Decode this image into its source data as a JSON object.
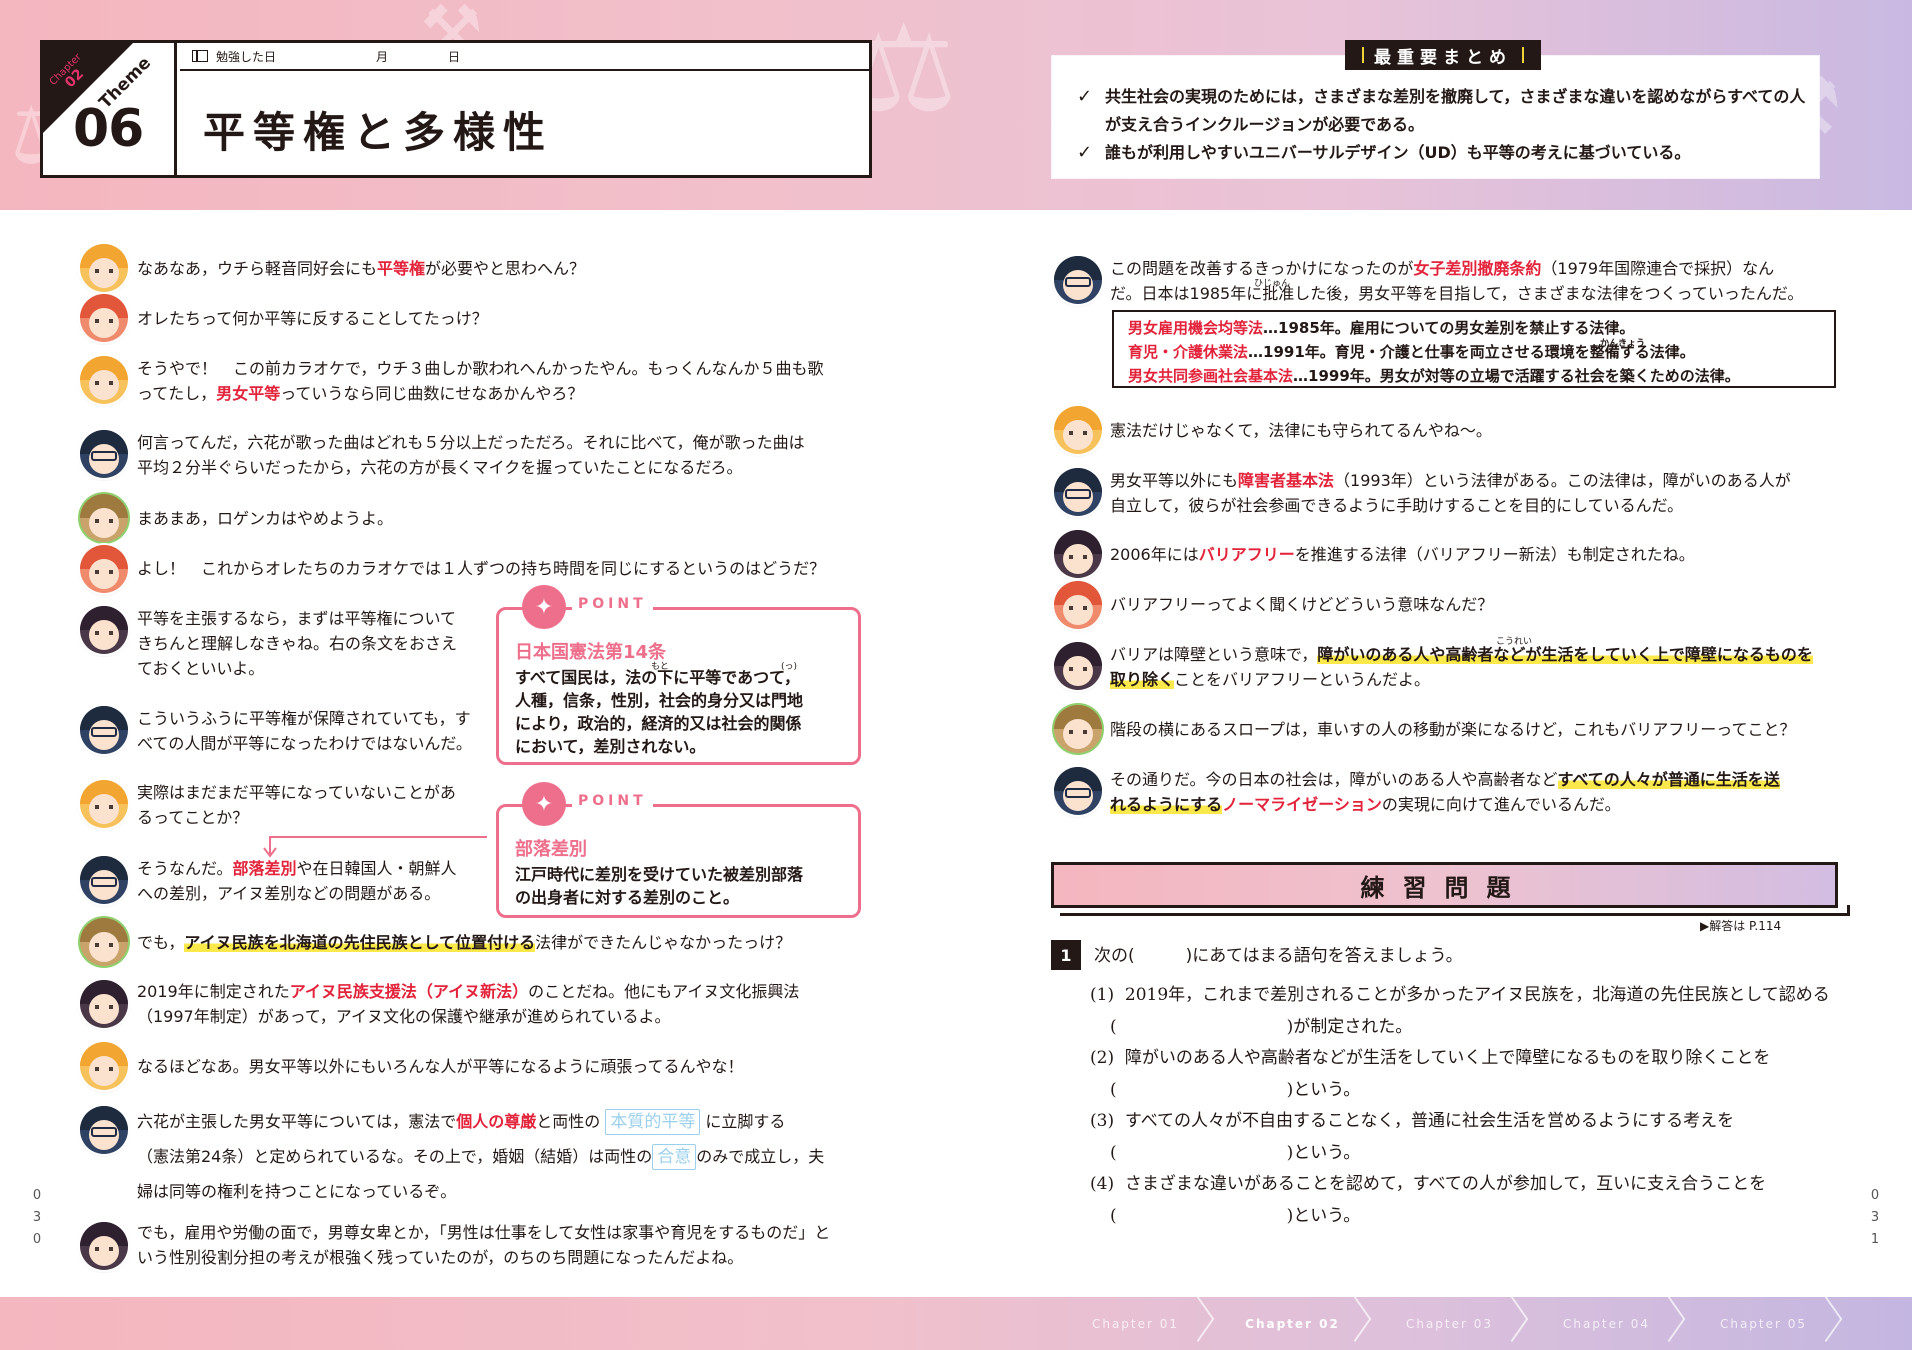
{
  "header": {
    "chapter_word": "Chapter",
    "chapter_num": "02",
    "theme_word": "Theme",
    "theme_num": "06",
    "study_label": "勉強した日",
    "month_label": "月",
    "day_label": "日",
    "title": "平等権と多様性"
  },
  "summary": {
    "heading": "最重要まとめ",
    "items": [
      "共生社会の実現のためには，さまざまな差別を撤廃して，さまざまな違いを認めながらすべての人が支え合うインクルージョンが必要である。",
      "誰もが利用しやすいユニバーサルデザイン（UD）も平等の考えに基づいている。"
    ]
  },
  "left": {
    "d1": {
      "a": "なあなあ，ウチら軽音同好会にも",
      "b": "平等権",
      "c": "が必要やと思わへん？"
    },
    "d2": "オレたちって何か平等に反することしてたっけ？",
    "d3": {
      "a": "そうやで！　この前カラオケで，ウチ３曲しか歌われへんかったやん。もっくんなんか５曲も歌",
      "b": "ってたし，",
      "c": "男女平等",
      "d": "っていうなら同じ曲数にせなあかんやろ？"
    },
    "d4": {
      "a": "何言ってんだ，六花が歌った曲はどれも５分以上だっただろ。それに比べて，俺が歌った曲は",
      "b": "平均２分半ぐらいだったから，六花の方が長くマイクを握っていたことになるだろ。"
    },
    "d5": "まあまあ，ロゲンカはやめようよ。",
    "d6": "よし！　これからオレたちのカラオケでは１人ずつの持ち時間を同じにするというのはどうだ？",
    "d7": {
      "a": "平等を主張するなら，まずは平等権について",
      "b": "きちんと理解しなきゃね。右の条文をおさえ",
      "c": "ておくといいよ。"
    },
    "d8": {
      "a": "こういうふうに平等権が保障されていても，す",
      "b": "べての人間が平等になったわけではないんだ。"
    },
    "d9": {
      "a": "実際はまだまだ平等になっていないことがあ",
      "b": "るってことか？"
    },
    "d10": {
      "a": "そうなんだ。",
      "b": "部落差別",
      "c": "や在日韓国人・朝鮮人",
      "d": "への差別，アイヌ差別などの問題がある。"
    },
    "d11": {
      "a": "でも，",
      "b": "アイヌ民族を北海道の先住民族として位置付ける",
      "c": "法律ができたんじゃなかったっけ？"
    },
    "d12": {
      "a": "2019年に制定された",
      "b": "アイヌ民族支援法（アイヌ新法）",
      "c": "のことだね。他にもアイヌ文化振興法",
      "d": "（1997年制定）があって，アイヌ文化の保護や継承が進められているよ。"
    },
    "d13": "なるほどなあ。男女平等以外にもいろんな人が平等になるように頑張ってるんやな！",
    "d14": {
      "a": "六花が主張した男女平等については，憲法で",
      "b": "個人の尊厳",
      "c": "と両性の",
      "d": "本質的平等",
      "e": "に立脚する",
      "f": "（憲法第24条）と定められているな。その上で，婚姻（結婚）は両性の",
      "g": "合意",
      "h": "のみで成立し，夫",
      "i": "婦は同等の権利を持つことになっているぞ。"
    },
    "d15": {
      "a": "でも，雇用や労働の面で，男尊女卑とか，「男性は仕事をして女性は家事や育児をするものだ」と",
      "b": "いう性別役割分担の考えが根強く残っていたのが，のちのち問題になったんだよね。"
    }
  },
  "point1": {
    "label": "POINT",
    "title": "日本国憲法第14条",
    "lines": [
      "すべて国民は，法の下に平等であつて，",
      "人種，信条，性別，社会的身分又は門地",
      "により，政治的，経済的又は社会的関係",
      "において，差別されない。"
    ],
    "ruby_shita": "もと",
    "ruby_tsu": "(っ)"
  },
  "point2": {
    "label": "POINT",
    "title": "部落差別",
    "lines": [
      "江戸時代に差別を受けていた被差別部落",
      "の出身者に対する差別のこと。"
    ]
  },
  "right": {
    "r1": {
      "a": "この問題を改善するきっかけになったのが",
      "b": "女子差別撤廃条約",
      "c": "（1979年国際連合で採択）なん",
      "d": "だ。日本は1985年に批准した後，男女平等を目指して，さまざまな法律をつくっていったんだ。",
      "ruby": "ひじゅん"
    },
    "laws": [
      {
        "name": "男女雇用機会均等法",
        "desc": "…1985年。雇用についての男女差別を禁止する法律。"
      },
      {
        "name": "育児・介護休業法",
        "desc": "…1991年。育児・介護と仕事を両立させる環境を整備する法律。"
      },
      {
        "name": "男女共同参画社会基本法",
        "desc": "…1999年。男女が対等の立場で活躍する社会を築くための法律。"
      }
    ],
    "law_ruby": "かんきょう",
    "r2": "憲法だけじゃなくて，法律にも守られてるんやね～。",
    "r3": {
      "a": "男女平等以外にも",
      "b": "障害者基本法",
      "c": "（1993年）という法律がある。この法律は，障がいのある人が",
      "d": "自立して，彼らが社会参画できるように手助けすることを目的にしているんだ。"
    },
    "r4": {
      "a": "2006年には",
      "b": "バリアフリー",
      "c": "を推進する法律（バリアフリー新法）も制定されたね。"
    },
    "r5": "バリアフリーってよく聞くけどどういう意味なんだ？",
    "r6": {
      "a": "バリアは障壁という意味で，",
      "b": "障がいのある人や高齢者などが生活をしていく上で障壁になるものを",
      "c": "取り除く",
      "d": "ことをバリアフリーというんだよ。",
      "ruby": "こうれい"
    },
    "r7": "階段の横にあるスロープは，車いすの人の移動が楽になるけど，これもバリアフリーってこと？",
    "r8": {
      "a": "その通りだ。今の日本の社会は，障がいのある人や高齢者など",
      "b": "すべての人々が普通に生活を送",
      "c": "れるようにする",
      "d": "ノーマライゼーション",
      "e": "の実現に向けて進んでいるんだ。"
    }
  },
  "practice": {
    "heading": "練習問題",
    "answer_ref": "▶解答は P.114",
    "q_num": "1",
    "lead": "次の(　　　)にあてはまる語句を答えましょう。",
    "items": [
      {
        "n": "(1)",
        "line1": "2019年，これまで差別されることが多かったアイヌ民族を，北海道の先住民族として認める",
        "line2": "(　　　　　　　　　　)が制定された。"
      },
      {
        "n": "(2)",
        "line1": "障がいのある人や高齢者などが生活をしていく上で障壁になるものを取り除くことを",
        "line2": "(　　　　　　　　　　)という。"
      },
      {
        "n": "(3)",
        "line1": "すべての人々が不自由することなく，普通に社会生活を営めるようにする考えを",
        "line2": "(　　　　　　　　　　)という。"
      },
      {
        "n": "(4)",
        "line1": "さまざまな違いがあることを認めて，すべての人が参加して，互いに支え合うことを",
        "line2": "(　　　　　　　　　　)という。"
      }
    ]
  },
  "page_left": [
    "0",
    "3",
    "0"
  ],
  "page_right": [
    "0",
    "3",
    "1"
  ],
  "chapters": [
    "Chapter 01",
    "Chapter 02",
    "Chapter 03",
    "Chapter 04",
    "Chapter 05"
  ]
}
